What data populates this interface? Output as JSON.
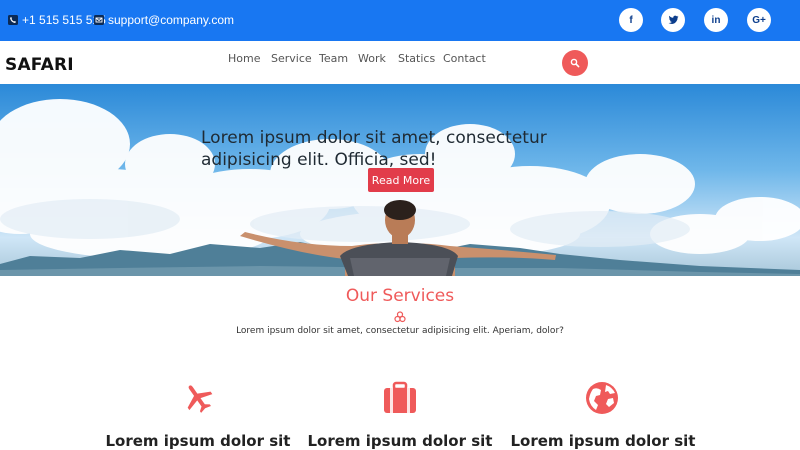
{
  "topbar": {
    "phone": "+1 515 515 515",
    "email": "support@company.com",
    "social": [
      {
        "icon": "facebook-icon",
        "label": "f"
      },
      {
        "icon": "twitter-icon",
        "label": "t"
      },
      {
        "icon": "linkedin-icon",
        "label": "in"
      },
      {
        "icon": "google-plus-icon",
        "label": "G+"
      }
    ]
  },
  "nav": {
    "brand": "SAFARI",
    "items": [
      "Home",
      "Service",
      "Team",
      "Work",
      "Statics",
      "Contact"
    ]
  },
  "hero": {
    "title": "Lorem ipsum dolor sit amet, consectetur adipisicing elit. Officia, sed!",
    "button": "Read More"
  },
  "services": {
    "title": "Our Services",
    "subtitle": "Lorem ipsum dolor sit amet, consectetur adipisicing elit. Aperiam, dolor?",
    "items": [
      {
        "icon": "plane-icon",
        "heading": "Lorem ipsum dolor sit"
      },
      {
        "icon": "briefcase-icon",
        "heading": "Lorem ipsum dolor sit"
      },
      {
        "icon": "globe-icon",
        "heading": "Lorem ipsum dolor sit"
      }
    ]
  },
  "colors": {
    "topbar": "#1877f2",
    "accent": "#ef5a5a",
    "button": "#e23c4a"
  }
}
